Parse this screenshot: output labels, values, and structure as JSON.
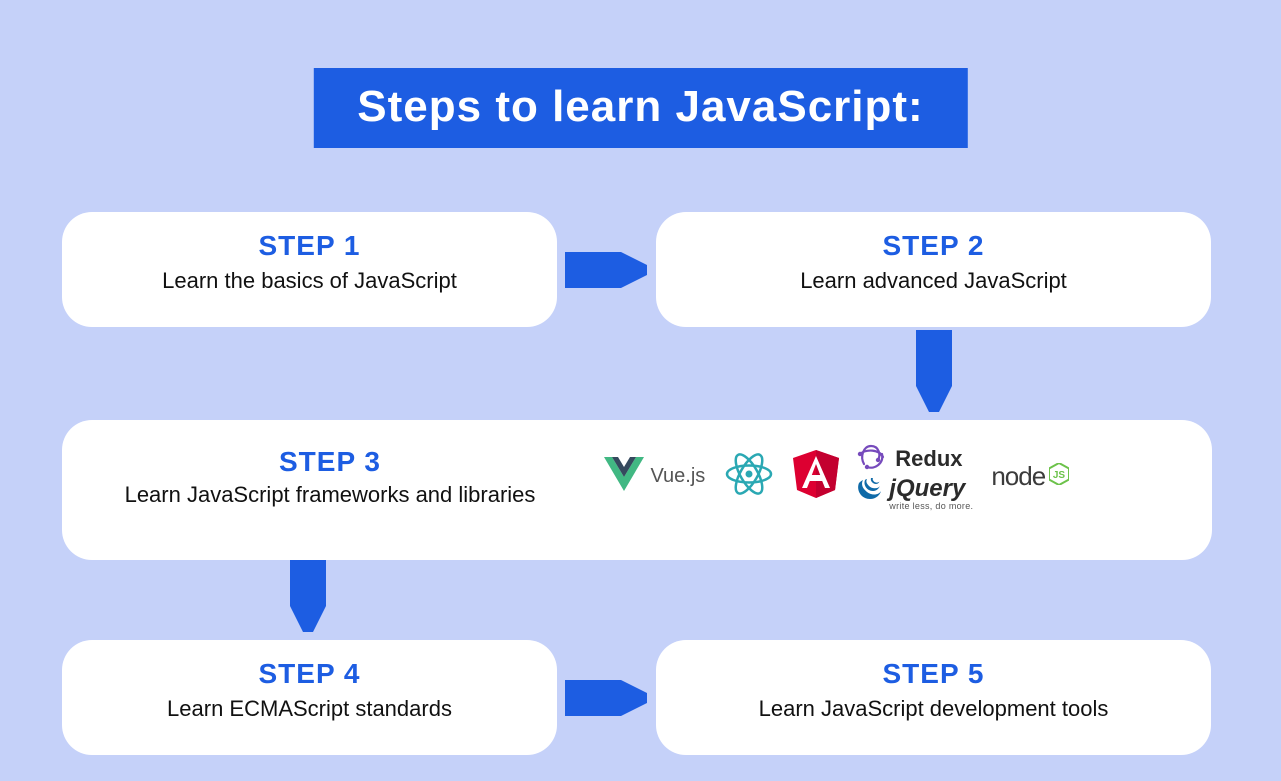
{
  "title": "Steps to learn JavaScript:",
  "steps": [
    {
      "label": "STEP 1",
      "desc": "Learn the basics of JavaScript"
    },
    {
      "label": "STEP 2",
      "desc": "Learn advanced JavaScript"
    },
    {
      "label": "STEP 3",
      "desc": "Learn JavaScript frameworks and libraries"
    },
    {
      "label": "STEP 4",
      "desc": "Learn ECMAScript standards"
    },
    {
      "label": "STEP 5",
      "desc": "Learn JavaScript development tools"
    }
  ],
  "logos": {
    "vue": "Vue.js",
    "react": "React",
    "angular": "Angular",
    "redux": "Redux",
    "jquery": "jQuery",
    "jquery_tag": "write less, do more.",
    "node": "node"
  },
  "colors": {
    "accent": "#1d5de2",
    "background": "#c5d1f9",
    "card": "#ffffff",
    "text": "#111111"
  }
}
